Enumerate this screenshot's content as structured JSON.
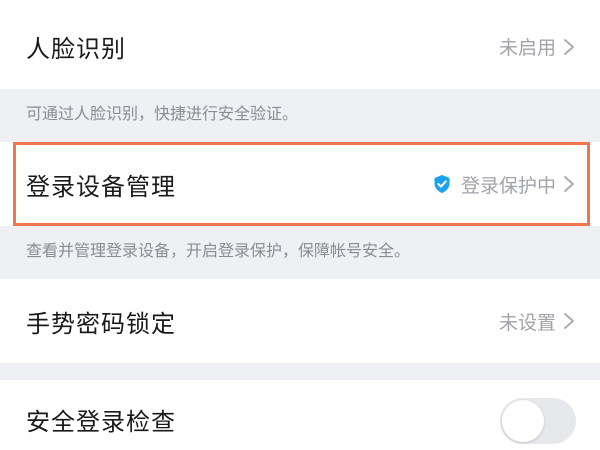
{
  "face": {
    "title": "人脸识别",
    "value": "未启用",
    "hint": "可通过人脸识别，快捷进行安全验证。"
  },
  "device": {
    "title": "登录设备管理",
    "value": "登录保护中",
    "hint": "查看并管理登录设备，开启登录保护，保障帐号安全。"
  },
  "gesture": {
    "title": "手势密码锁定",
    "value": "未设置"
  },
  "safe_login": {
    "title": "安全登录检查",
    "toggle_on": false
  },
  "colors": {
    "highlight": "#f07548",
    "shield": "#1aa2f0"
  }
}
